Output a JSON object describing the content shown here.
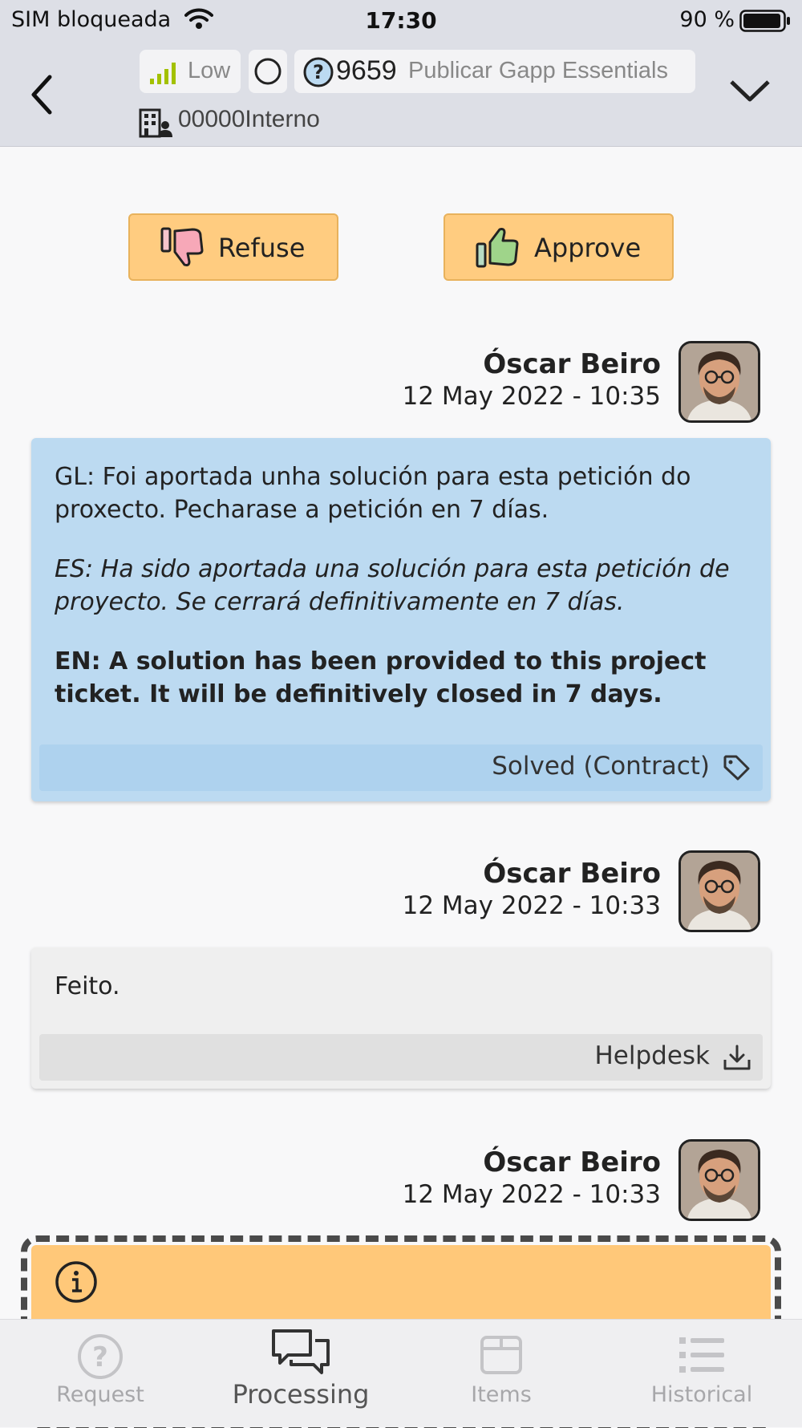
{
  "status_bar": {
    "carrier": "SIM bloqueada",
    "time": "17:30",
    "battery": "90 %"
  },
  "header": {
    "priority": "Low",
    "ticket_number": "9659",
    "ticket_title": "Publicar Gapp Essentials",
    "company": "00000Interno"
  },
  "actions": {
    "refuse": "Refuse",
    "approve": "Approve"
  },
  "messages": [
    {
      "author": "Óscar Beiro",
      "date": "12 May 2022 - 10:35",
      "text_gl": "GL: Foi aportada unha solución para esta petición do proxecto. Pecharase a petición en 7 días.",
      "text_es": "ES: Ha sido aportada una solución para esta petición de proyecto. Se cerrará definitivamente en 7 días.",
      "text_en": "EN: A solution has been provided to this project ticket. It will be definitively closed in 7 days.",
      "footer": "Solved (Contract)",
      "footer_icon": "tag-icon",
      "color": "#bcdaf1"
    },
    {
      "author": "Óscar Beiro",
      "date": "12 May 2022 - 10:33",
      "text": "Feito.",
      "footer": "Helpdesk",
      "footer_icon": "download-icon",
      "color": "#efefef"
    },
    {
      "author": "Óscar Beiro",
      "date": "12 May 2022 - 10:33",
      "icon": "info-icon",
      "color": "#ffc879"
    }
  ],
  "tabs": [
    {
      "label": "Request",
      "icon": "question-icon"
    },
    {
      "label": "Processing",
      "icon": "chat-icon",
      "active": true
    },
    {
      "label": "Items",
      "icon": "box-icon"
    },
    {
      "label": "Historical",
      "icon": "list-icon"
    }
  ],
  "colors": {
    "accent": "#ffcc80",
    "header_bg": "#dddfe6",
    "solved_bg": "#bcdaf1",
    "info_bg": "#ffc879"
  }
}
